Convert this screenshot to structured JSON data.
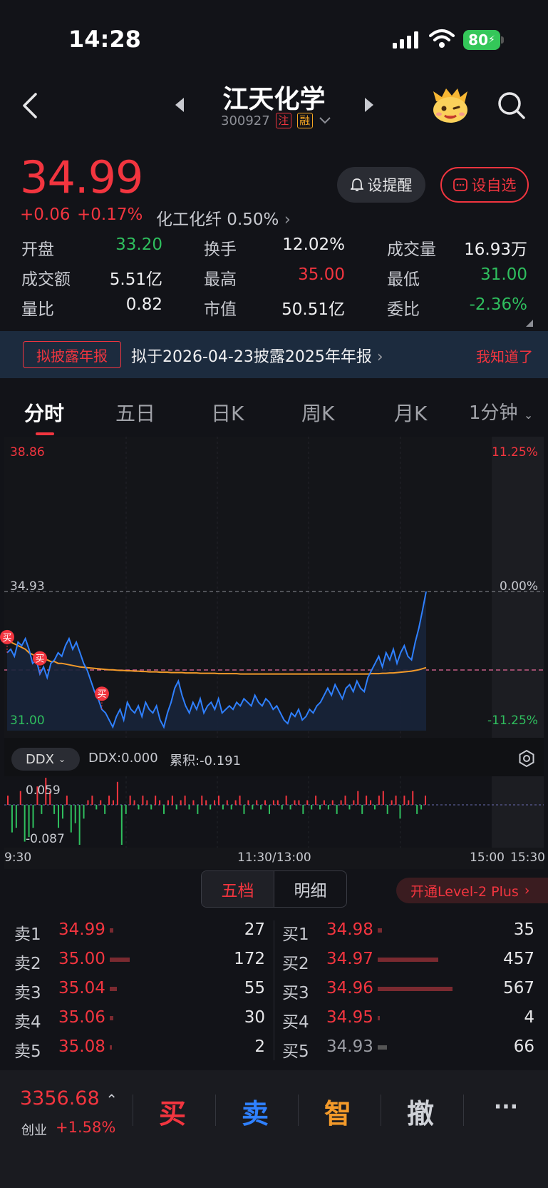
{
  "status": {
    "time": "14:28",
    "battery": "80"
  },
  "nav": {
    "name": "江天化学",
    "code": "300927",
    "tag1": "注",
    "tag2": "融"
  },
  "quote": {
    "price": "34.99",
    "change": "+0.06",
    "change_pct": "+0.17%",
    "sector": "化工化纤 0.50%",
    "remind_label": "设提醒",
    "watch_label": "设自选"
  },
  "stats": [
    {
      "label": "开盘",
      "value": "33.20",
      "color": "#2fbf5e"
    },
    {
      "label": "换手",
      "value": "12.02%",
      "color": "#f0f0f2"
    },
    {
      "label": "成交量",
      "value": "16.93万",
      "color": "#f0f0f2"
    },
    {
      "label": "成交额",
      "value": "5.51亿",
      "color": "#f0f0f2"
    },
    {
      "label": "最高",
      "value": "35.00",
      "color": "#f2353f"
    },
    {
      "label": "最低",
      "value": "31.00",
      "color": "#2fbf5e"
    },
    {
      "label": "量比",
      "value": "0.82",
      "color": "#f0f0f2"
    },
    {
      "label": "市值",
      "value": "50.51亿",
      "color": "#f0f0f2"
    },
    {
      "label": "委比",
      "value": "-2.36%",
      "color": "#2fbf5e"
    }
  ],
  "notice": {
    "tag": "拟披露年报",
    "text": "拟于2026-04-23披露2025年年报",
    "dismiss": "我知道了"
  },
  "tabs": [
    "分时",
    "五日",
    "日K",
    "周K",
    "月K",
    "1分钟"
  ],
  "chart_data": {
    "type": "line",
    "price_axis": {
      "top": "38.86",
      "mid": "34.93",
      "bottom": "31.00"
    },
    "pct_axis": {
      "top": "11.25%",
      "mid": "0.00%",
      "bottom": "-11.25%"
    },
    "ylim": [
      31.0,
      38.86
    ],
    "prev_close": 34.93,
    "time_labels": [
      "9:30",
      "11:30/13:00",
      "15:00",
      "15:30"
    ],
    "price_series": [
      33.2,
      33.3,
      33.1,
      33.5,
      33.4,
      33.6,
      33.3,
      32.9,
      33.0,
      32.6,
      32.8,
      32.5,
      32.9,
      33.0,
      33.2,
      33.1,
      33.4,
      33.6,
      33.3,
      33.5,
      33.2,
      32.9,
      32.7,
      32.4,
      32.1,
      31.9,
      31.6,
      31.5,
      31.3,
      31.1,
      31.4,
      31.6,
      31.3,
      31.8,
      31.6,
      31.5,
      31.7,
      31.4,
      31.8,
      31.6,
      31.5,
      31.7,
      31.3,
      31.1,
      31.5,
      31.8,
      32.2,
      32.4,
      32.0,
      31.7,
      31.5,
      31.8,
      31.6,
      31.9,
      31.5,
      31.7,
      31.8,
      31.6,
      31.9,
      31.5,
      31.6,
      31.7,
      31.6,
      31.8,
      31.7,
      31.9,
      31.8,
      31.7,
      32.0,
      31.8,
      31.7,
      31.9,
      31.8,
      31.6,
      31.7,
      31.5,
      31.3,
      31.2,
      31.5,
      31.4,
      31.6,
      31.3,
      31.4,
      31.6,
      31.5,
      31.7,
      31.8,
      32.0,
      32.2,
      32.0,
      32.3,
      32.1,
      31.9,
      32.2,
      32.3,
      32.1,
      32.4,
      32.2,
      32.1,
      32.5,
      32.7,
      32.9,
      33.1,
      32.8,
      33.2,
      33.0,
      33.3,
      32.9,
      33.2,
      33.4,
      33.1,
      33.0,
      33.5,
      33.9,
      34.4,
      34.93
    ],
    "avg_series": [
      33.5,
      33.5,
      33.45,
      33.4,
      33.35,
      33.3,
      33.2,
      33.15,
      33.1,
      33.05,
      33.0,
      33.0,
      32.95,
      32.95,
      32.9,
      32.9,
      32.88,
      32.86,
      32.84,
      32.82,
      32.8,
      32.79,
      32.78,
      32.77,
      32.76,
      32.75,
      32.74,
      32.73,
      32.72,
      32.72,
      32.71,
      32.7,
      32.7,
      32.69,
      32.69,
      32.68,
      32.68,
      32.67,
      32.67,
      32.66,
      32.66,
      32.66,
      32.65,
      32.65,
      32.65,
      32.64,
      32.64,
      32.64,
      32.64,
      32.63,
      32.63,
      32.63,
      32.63,
      32.62,
      32.62,
      32.62,
      32.62,
      32.62,
      32.61,
      32.61,
      32.61,
      32.61,
      32.61,
      32.61,
      32.6,
      32.6,
      32.6,
      32.6,
      32.6,
      32.6,
      32.6,
      32.6,
      32.6,
      32.6,
      32.6,
      32.6,
      32.6,
      32.6,
      32.6,
      32.6,
      32.6,
      32.6,
      32.6,
      32.6,
      32.6,
      32.6,
      32.6,
      32.6,
      32.6,
      32.6,
      32.6,
      32.6,
      32.6,
      32.6,
      32.6,
      32.6,
      32.6,
      32.6,
      32.6,
      32.6,
      32.61,
      32.61,
      32.61,
      32.62,
      32.62,
      32.63,
      32.63,
      32.64,
      32.65,
      32.66,
      32.67,
      32.68,
      32.7,
      32.72,
      32.75,
      32.78
    ],
    "buy_markers": [
      {
        "index": 0,
        "label": "买"
      },
      {
        "index": 9,
        "label": "买"
      },
      {
        "index": 26,
        "label": "买"
      }
    ],
    "ddx": {
      "label": "DDX",
      "value_text": "DDX:0.000",
      "acc_text": "累积:-0.191",
      "max_label": "0.059",
      "min_label": "-0.087",
      "values": [
        0.02,
        -0.06,
        -0.05,
        0.03,
        -0.08,
        -0.07,
        -0.05,
        0.04,
        -0.02,
        0.059,
        0.03,
        -0.02,
        -0.05,
        -0.03,
        0.02,
        -0.06,
        -0.04,
        -0.087,
        -0.03,
        0.01,
        0.02,
        -0.01,
        0.01,
        -0.02,
        0.02,
        0.01,
        0.05,
        -0.087,
        -0.02,
        0.02,
        0.01,
        -0.01,
        0.02,
        0.01,
        -0.01,
        0.02,
        0.01,
        -0.02,
        0.01,
        0.02,
        -0.01,
        0.01,
        0.02,
        -0.01,
        0.01,
        -0.02,
        0.02,
        0.01,
        -0.01,
        0.01,
        0.02,
        -0.01,
        0.01,
        -0.01,
        0.01,
        0.02,
        -0.02,
        0.01,
        -0.01,
        0.01,
        -0.01,
        0.01,
        -0.02,
        0.01,
        0.01,
        -0.01,
        0.02,
        -0.01,
        0.01,
        0.01,
        -0.02,
        0.01,
        -0.01,
        0.02,
        -0.01,
        0.01,
        -0.01,
        0.01,
        -0.02,
        0.01,
        0.02,
        -0.01,
        0.01,
        0.03,
        -0.02,
        0.02,
        0.01,
        -0.01,
        0.02,
        0.03,
        -0.02,
        0.01,
        0.02,
        -0.03,
        0.02,
        0.01,
        0.03,
        -0.02,
        -0.01,
        0.02
      ]
    }
  },
  "orderbook": {
    "seg_five": "五档",
    "seg_detail": "明细",
    "level2": "开通Level-2 Plus",
    "sells": [
      {
        "label": "卖1",
        "price": "34.99",
        "vol": "27",
        "color": "#f2353f",
        "bar": 0.02
      },
      {
        "label": "卖2",
        "price": "35.00",
        "vol": "172",
        "color": "#f2353f",
        "bar": 0.11
      },
      {
        "label": "卖3",
        "price": "35.04",
        "vol": "55",
        "color": "#f2353f",
        "bar": 0.04
      },
      {
        "label": "卖4",
        "price": "35.06",
        "vol": "30",
        "color": "#f2353f",
        "bar": 0.02
      },
      {
        "label": "卖5",
        "price": "35.08",
        "vol": "2",
        "color": "#f2353f",
        "bar": 0.005
      }
    ],
    "buys": [
      {
        "label": "买1",
        "price": "34.98",
        "vol": "35",
        "color": "#f2353f",
        "bar": 0.025
      },
      {
        "label": "买2",
        "price": "34.97",
        "vol": "457",
        "color": "#f2353f",
        "bar": 0.33
      },
      {
        "label": "买3",
        "price": "34.96",
        "vol": "567",
        "color": "#f2353f",
        "bar": 0.41
      },
      {
        "label": "买4",
        "price": "34.95",
        "vol": "4",
        "color": "#f2353f",
        "bar": 0.004
      },
      {
        "label": "买5",
        "price": "34.93",
        "vol": "66",
        "color": "#9a9ca3",
        "bar": 0.05
      }
    ]
  },
  "bottom": {
    "index_value": "3356.68",
    "index_name": "创业",
    "index_pct": "+1.58%",
    "buy": "买",
    "sell": "卖",
    "smart": "智",
    "cancel": "撤",
    "more": "···"
  },
  "colors": {
    "red": "#f2353f",
    "green": "#2fbf5e",
    "blue": "#2f80ff",
    "orange": "#f39a2a"
  }
}
